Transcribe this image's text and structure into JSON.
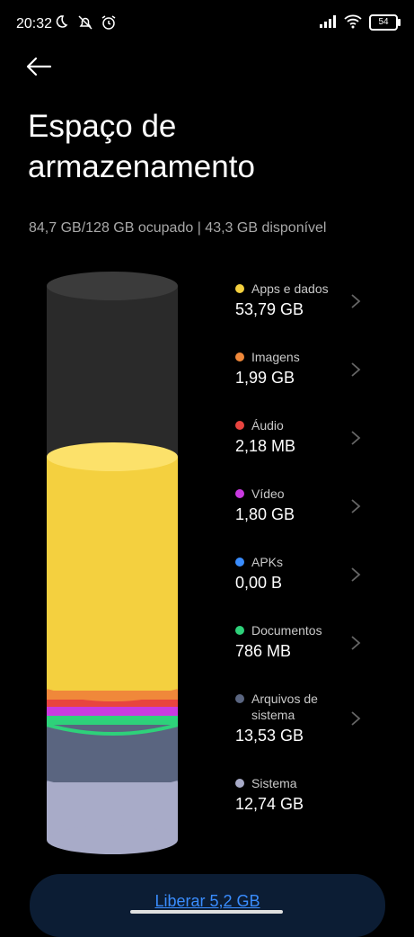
{
  "status_bar": {
    "time": "20:32",
    "battery": "54"
  },
  "header": {
    "title": "Espaço de armazenamento",
    "summary": "84,7 GB/128 GB ocupado | 43,3 GB disponível"
  },
  "storage": {
    "used_gb": 84.7,
    "total_gb": 128,
    "categories": [
      {
        "label": "Apps e dados",
        "value": "53,79 GB",
        "color": "#f4d03f"
      },
      {
        "label": "Imagens",
        "value": "1,99 GB",
        "color": "#f0883a"
      },
      {
        "label": "Áudio",
        "value": "2,18 MB",
        "color": "#e8443f"
      },
      {
        "label": "Vídeo",
        "value": "1,80 GB",
        "color": "#c93ae0"
      },
      {
        "label": "APKs",
        "value": "0,00 B",
        "color": "#3a8dff"
      },
      {
        "label": "Documentos",
        "value": "786 MB",
        "color": "#2ed17a"
      },
      {
        "label": "Arquivos de sistema",
        "value": "13,53 GB",
        "color": "#5a6580"
      },
      {
        "label": "Sistema",
        "value": "12,74 GB",
        "color": "#a8abc8"
      }
    ]
  },
  "footer": {
    "free_label": "Liberar 5,2 GB"
  },
  "colors": {
    "accent": "#3a8dff",
    "background": "#000000"
  }
}
